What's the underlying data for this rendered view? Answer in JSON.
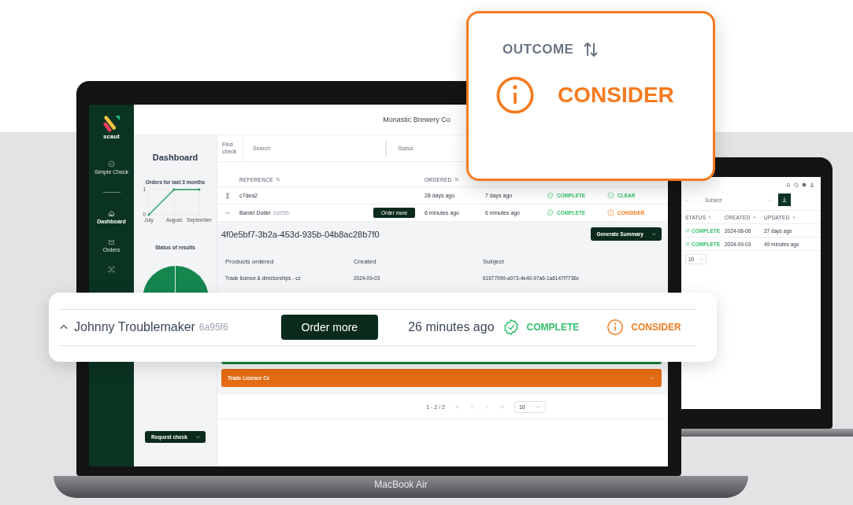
{
  "main_laptop": {
    "label": "MacBook Air",
    "sidebar": {
      "logo": "scaut",
      "items": [
        {
          "label": "Simple Check",
          "kind": "check",
          "selected": false
        },
        {
          "label": "Dashboard",
          "kind": "home",
          "selected": true
        },
        {
          "label": "Orders",
          "kind": "basket",
          "selected": false
        },
        {
          "kind": "person",
          "selected": false
        }
      ]
    },
    "header": {
      "company": "Monastic Brewery Co"
    },
    "dashboard": {
      "title": "Dashboard",
      "chart_data": {
        "type": "line",
        "title": "Orders for last 3 months",
        "categories": [
          "July",
          "August",
          "September"
        ],
        "series": [
          {
            "color": "#1f9a5a",
            "values": [
              0,
              1,
              1
            ]
          }
        ],
        "ylim": [
          0,
          1
        ],
        "yticks": [
          0,
          1
        ]
      },
      "pie_title": "Status of results",
      "request_button": "Request check"
    },
    "filters": {
      "label": "Find check",
      "search_placeholder": "Search",
      "status_placeholder": "Status"
    },
    "table": {
      "columns": [
        {
          "kind": "reference",
          "label": "REFERENCE"
        },
        {
          "kind": "ordered",
          "label": "ORDERED"
        }
      ],
      "rows": [
        {
          "expanded": false,
          "reference": "c7dea2",
          "ordered": "28 days ago",
          "column_5": "7 days ago",
          "status": {
            "kind": "complete",
            "label": "COMPLETE"
          },
          "outcome": {
            "kind": "clear",
            "label": "CLEAR"
          }
        },
        {
          "expanded": true,
          "reference": "Baniel Dutler",
          "ref_id": "6a95f6",
          "action": "Order more",
          "ordered": "6 minutes ago",
          "column_5": "6 minutes ago",
          "status": {
            "kind": "complete",
            "label": "COMPLETE"
          },
          "outcome": {
            "kind": "consider",
            "label": "CONSIDER"
          }
        }
      ]
    },
    "detail": {
      "id": "4f0e5bf7-3b2a-453d-935b-04b8ac28b7f0",
      "summary_button": "Generate Summary",
      "columns": [
        "Products ordered",
        "Created",
        "Subject"
      ],
      "rows": [
        [
          "Trade licence & directorships - cz",
          "2024-09-03",
          "61677999-a073-4e40-97a6-1a6147f7736c"
        ]
      ],
      "sections": [
        {
          "color": "#1b7f3a"
        },
        {
          "color": "#e46c14",
          "label": "Trade Licence Cz"
        }
      ]
    },
    "pagination": {
      "range": "1 - 2 / 2",
      "page_size": "10"
    }
  },
  "second_laptop": {
    "subject_placeholder": "Subject",
    "columns": [
      "STATUS",
      "CREATED",
      "UPDATED"
    ],
    "rows": [
      {
        "status": {
          "kind": "complete",
          "label": "COMPLETE"
        },
        "created": "2024-08-06",
        "updated": "27 days ago"
      },
      {
        "status": {
          "kind": "complete",
          "label": "COMPLETE"
        },
        "created": "2024-09-03",
        "updated": "49 minutes ago"
      }
    ],
    "page_size": "10"
  },
  "outcome_callout": {
    "heading": "OUTCOME",
    "outcome": {
      "kind": "consider",
      "label": "CONSIDER"
    }
  },
  "row_callout": {
    "expanded": true,
    "name": "Johnny Troublemaker",
    "id": "6a95f6",
    "action": "Order more",
    "ordered": "26 minutes ago",
    "status": {
      "kind": "complete",
      "label": "COMPLETE"
    },
    "outcome": {
      "kind": "consider",
      "label": "CONSIDER"
    }
  }
}
